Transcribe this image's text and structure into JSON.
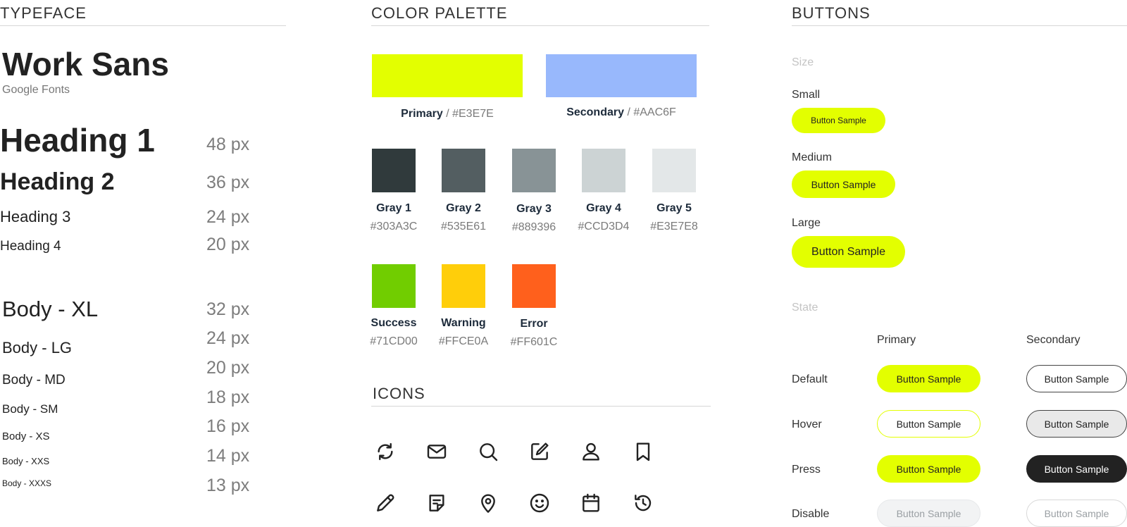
{
  "typeface": {
    "section_title": "TYPEFACE",
    "font_name": "Work Sans",
    "font_source": "Google Fonts",
    "styles": [
      {
        "label": "Heading 1",
        "size": "48 px"
      },
      {
        "label": "Heading 2",
        "size": "36 px"
      },
      {
        "label": "Heading 3",
        "size": "24 px"
      },
      {
        "label": "Heading 4",
        "size": "20 px"
      },
      {
        "label": "Body - XL",
        "size": "32 px"
      },
      {
        "label": "Body - LG",
        "size": "24 px"
      },
      {
        "label": "Body - MD",
        "size": "20 px"
      },
      {
        "label": "Body - SM",
        "size": "18 px"
      },
      {
        "label": "Body - XS",
        "size": "16 px"
      },
      {
        "label": "Body - XXS",
        "size": "14 px"
      },
      {
        "label": "Body - XXXS",
        "size": "13 px"
      }
    ]
  },
  "palette": {
    "section_title": "COLOR PALETTE",
    "primary": {
      "name": "Primary",
      "sep": " / ",
      "hex": "#E3E7E",
      "color": "#E3FF00"
    },
    "secondary": {
      "name": "Secondary",
      "sep": " / ",
      "hex": "#AAC6F",
      "color": "#98B8FC"
    },
    "grays": [
      {
        "name": "Gray 1",
        "hex": "#303A3C",
        "color": "#303A3C"
      },
      {
        "name": "Gray 2",
        "hex": "#535E61",
        "color": "#535E61"
      },
      {
        "name": "Gray 3",
        "hex": "#889396",
        "color": "#889396"
      },
      {
        "name": "Gray 4",
        "hex": "#CCD3D4",
        "color": "#CCD3D4"
      },
      {
        "name": "Gray 5",
        "hex": "#E3E7E8",
        "color": "#E3E7E8"
      }
    ],
    "status": [
      {
        "name": "Success",
        "hex": "#71CD00",
        "color": "#71CD00"
      },
      {
        "name": "Warning",
        "hex": "#FFCE0A",
        "color": "#FFCE0A"
      },
      {
        "name": "Error",
        "hex": "#FF601C",
        "color": "#FF601C"
      }
    ]
  },
  "icons": {
    "section_title": "ICONS",
    "row1": [
      "refresh-icon",
      "mail-icon",
      "search-icon",
      "edit-icon",
      "user-icon",
      "bookmark-icon"
    ],
    "row2": [
      "pencil-icon",
      "note-icon",
      "location-pin-icon",
      "smiley-icon",
      "calendar-icon",
      "history-icon"
    ]
  },
  "buttons": {
    "section_title": "BUTTONS",
    "size_label": "Size",
    "sizes": [
      {
        "label": "Small",
        "button": "Button Sample"
      },
      {
        "label": "Medium",
        "button": "Button Sample"
      },
      {
        "label": "Large",
        "button": "Button Sample"
      }
    ],
    "state_label": "State",
    "col_primary": "Primary",
    "col_secondary": "Secondary",
    "states": [
      {
        "label": "Default",
        "primary": "Button Sample",
        "secondary": "Button Sample"
      },
      {
        "label": "Hover",
        "primary": "Button Sample",
        "secondary": "Button Sample"
      },
      {
        "label": "Press",
        "primary": "Button Sample",
        "secondary": "Button Sample"
      },
      {
        "label": "Disable",
        "primary": "Button Sample",
        "secondary": "Button Sample"
      }
    ],
    "colors": {
      "accent": "#E3FF00",
      "dark": "#222222",
      "hover_gray": "#E9E9E9",
      "disabled_bg": "#F2F3F4"
    }
  }
}
